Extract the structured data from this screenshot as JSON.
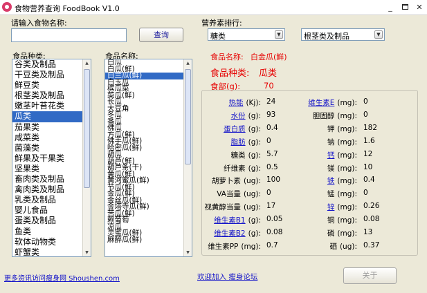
{
  "window": {
    "title": "食物营养查询 FoodBook V1.0",
    "minimize": "_",
    "close": "✕"
  },
  "search": {
    "label": "请输入食物名称:",
    "value": "",
    "button": "查询"
  },
  "ranking": {
    "label": "营养素排行:",
    "nutrient": "糖类",
    "category": "根茎类及制品"
  },
  "categories": {
    "label": "食品种类:",
    "items": [
      "谷类及制品",
      "干豆类及制品",
      "鲜豆类",
      "根茎类及制品",
      "嫩茎叶苔花类",
      "瓜类",
      "茄果类",
      "咸菜类",
      "菌藻类",
      "鲜果及干果类",
      "坚果类",
      "畜肉类及制品",
      "禽肉类及制品",
      "乳类及制品",
      "婴儿食品",
      "蛋类及制品",
      "鱼类",
      "软体动物类",
      "虾蟹类"
    ],
    "selected_index": 5
  },
  "foods": {
    "label": "食品名称:",
    "items": [
      "白瓜",
      "白瓜(鲜)",
      "白兰瓜(鲜)",
      "白玉瓜",
      "槟瓜菜",
      "菜瓜(鲜)",
      "长瓜",
      "大豆角",
      "冬瓜",
      "番瓜",
      "佛瓜",
      "方瓜(鲜)",
      "佛手瓜(鲜)",
      "哈密瓜(鲜)",
      "葫瓜",
      "葫芦(鲜)",
      "葫芦条(干)",
      "黄瓜(鲜)",
      "黄河蜜瓜(鲜)",
      "节瓜(鲜)",
      "金瓜(鲜)",
      "金丝瓜(鲜)",
      "金塔寺瓜(鲜)",
      "苦瓜(鲜)",
      "赖葡萄",
      "凉瓜",
      "灵蜜瓜(鲜)",
      "麻醉瓜(鲜)"
    ],
    "selected_index": 2
  },
  "detail": {
    "name_label": "食品名称:",
    "name_value": "白金瓜(鲜)",
    "category_label": "食品种类:",
    "category_value": "瓜类",
    "portion_label": "食部(g):",
    "portion_value": "70"
  },
  "nutrients_left": [
    {
      "label": "热能",
      "unit": "(Kj):",
      "value": "24",
      "link": true
    },
    {
      "label": "水份",
      "unit": "(g):",
      "value": "93",
      "link": true
    },
    {
      "label": "蛋白质",
      "unit": "(g):",
      "value": "0.4",
      "link": true
    },
    {
      "label": "脂肪",
      "unit": "(g):",
      "value": "0",
      "link": true
    },
    {
      "label": "糖类",
      "unit": "(g):",
      "value": "5.7",
      "link": false
    },
    {
      "label": "纤维素",
      "unit": "(g):",
      "value": "0.5",
      "link": false
    },
    {
      "label": "胡萝卜素",
      "unit": "(ug):",
      "value": "100",
      "link": false
    },
    {
      "label": "VA当量",
      "unit": "(ug):",
      "value": "0",
      "link": false
    },
    {
      "label": "视黄醇当量",
      "unit": "(ug):",
      "value": "17",
      "link": false
    },
    {
      "label": "维生素B1",
      "unit": "(g):",
      "value": "0.05",
      "link": true
    },
    {
      "label": "维生素B2",
      "unit": "(g):",
      "value": "0.08",
      "link": true
    },
    {
      "label": "维生素PP",
      "unit": "(mg):",
      "value": "0.7",
      "link": false
    }
  ],
  "nutrients_right": [
    {
      "label": "维生素E",
      "unit": "(mg):",
      "value": "0",
      "link": true
    },
    {
      "label": "胆固醇",
      "unit": "(mg):",
      "value": "0",
      "link": false
    },
    {
      "label": "钾",
      "unit": "(mg):",
      "value": "182",
      "link": false
    },
    {
      "label": "钠",
      "unit": "(mg):",
      "value": "1.6",
      "link": false
    },
    {
      "label": "钙",
      "unit": "(mg):",
      "value": "12",
      "link": true
    },
    {
      "label": "镁",
      "unit": "(mg):",
      "value": "10",
      "link": false
    },
    {
      "label": "铁",
      "unit": "(mg):",
      "value": "0.4",
      "link": true
    },
    {
      "label": "锰",
      "unit": "(mg):",
      "value": "0",
      "link": false
    },
    {
      "label": "锌",
      "unit": "(mg):",
      "value": "0.26",
      "link": true
    },
    {
      "label": "铜",
      "unit": "(mg):",
      "value": "0.08",
      "link": false
    },
    {
      "label": "磷",
      "unit": "(mg):",
      "value": "13",
      "link": false
    },
    {
      "label": "硒",
      "unit": "(ug):",
      "value": "0.37",
      "link": false
    }
  ],
  "footer": {
    "left_link": "更多资讯访问瘦身网 Shoushen.com",
    "mid_link": "欢迎加入 瘦身论坛",
    "about_button": "关于"
  }
}
